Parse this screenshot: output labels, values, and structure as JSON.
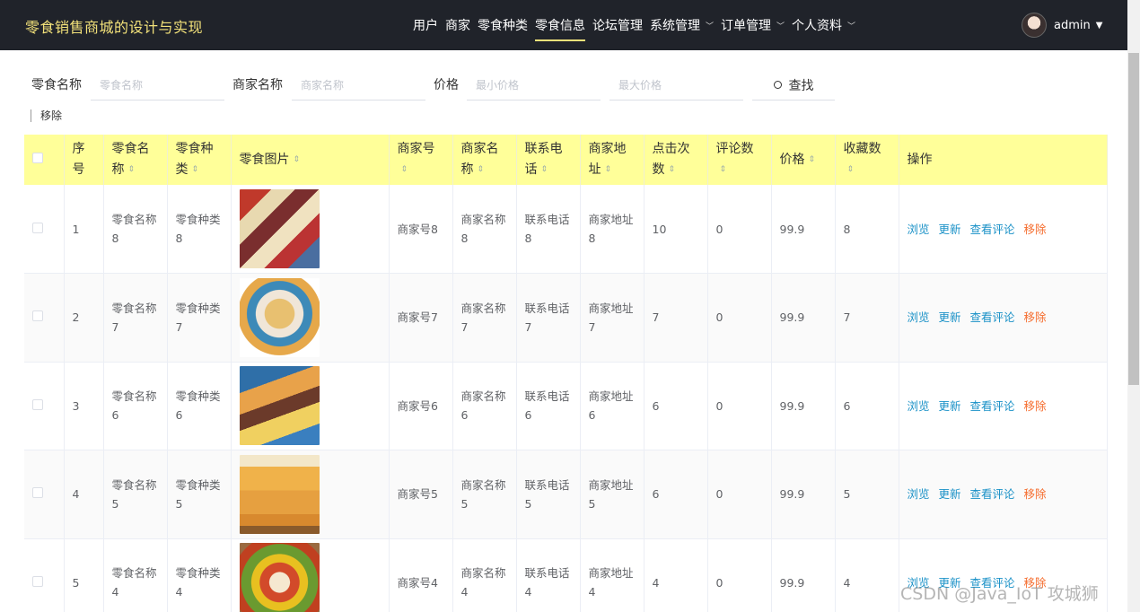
{
  "app": {
    "title": "零食销售商城的设计与实现"
  },
  "nav": {
    "items": [
      {
        "label": "用户",
        "dropdown": false,
        "active": false
      },
      {
        "label": "商家",
        "dropdown": false,
        "active": false
      },
      {
        "label": "零食种类",
        "dropdown": false,
        "active": false
      },
      {
        "label": "零食信息",
        "dropdown": false,
        "active": true
      },
      {
        "label": "论坛管理",
        "dropdown": false,
        "active": false
      },
      {
        "label": "系统管理",
        "dropdown": true,
        "active": false
      },
      {
        "label": "订单管理",
        "dropdown": true,
        "active": false
      },
      {
        "label": "个人资料",
        "dropdown": true,
        "active": false
      }
    ]
  },
  "user": {
    "name": "admin"
  },
  "search": {
    "snack_name_label": "零食名称",
    "snack_name_placeholder": "零食名称",
    "merchant_name_label": "商家名称",
    "merchant_name_placeholder": "商家名称",
    "price_label": "价格",
    "min_price_placeholder": "最小价格",
    "max_price_placeholder": "最大价格",
    "search_button": "查找"
  },
  "toolbar": {
    "remove_label": "移除"
  },
  "table": {
    "headers": {
      "index": "序号",
      "snack_name": "零食名称",
      "snack_type": "零食种类",
      "snack_image": "零食图片",
      "merchant_no": "商家号",
      "merchant_name": "商家名称",
      "phone": "联系电话",
      "address": "商家地址",
      "clicks": "点击次数",
      "comments": "评论数",
      "price": "价格",
      "favorites": "收藏数",
      "actions": "操作"
    },
    "actions": {
      "view": "浏览",
      "update": "更新",
      "comments": "查看评论",
      "remove": "移除"
    },
    "rows": [
      {
        "index": "1",
        "snack_name": "零食名称8",
        "snack_type": "零食种类8",
        "merchant_no": "商家号8",
        "merchant_name": "商家名称8",
        "phone": "联系电话8",
        "address": "商家地址8",
        "clicks": "10",
        "comments": "0",
        "price": "99.9",
        "favorites": "8"
      },
      {
        "index": "2",
        "snack_name": "零食名称7",
        "snack_type": "零食种类7",
        "merchant_no": "商家号7",
        "merchant_name": "商家名称7",
        "phone": "联系电话7",
        "address": "商家地址7",
        "clicks": "7",
        "comments": "0",
        "price": "99.9",
        "favorites": "7"
      },
      {
        "index": "3",
        "snack_name": "零食名称6",
        "snack_type": "零食种类6",
        "merchant_no": "商家号6",
        "merchant_name": "商家名称6",
        "phone": "联系电话6",
        "address": "商家地址6",
        "clicks": "6",
        "comments": "0",
        "price": "99.9",
        "favorites": "6"
      },
      {
        "index": "4",
        "snack_name": "零食名称5",
        "snack_type": "零食种类5",
        "merchant_no": "商家号5",
        "merchant_name": "商家名称5",
        "phone": "联系电话5",
        "address": "商家地址5",
        "clicks": "6",
        "comments": "0",
        "price": "99.9",
        "favorites": "5"
      },
      {
        "index": "5",
        "snack_name": "零食名称4",
        "snack_type": "零食种类4",
        "merchant_no": "商家号4",
        "merchant_name": "商家名称4",
        "phone": "联系电话4",
        "address": "商家地址4",
        "clicks": "4",
        "comments": "0",
        "price": "99.9",
        "favorites": "4"
      }
    ]
  },
  "watermark": "CSDN @Java_IoT 攻城狮",
  "colors": {
    "header_bg": "#20232a",
    "accent": "#f3e27a",
    "table_head_bg": "#ffff99",
    "link": "#1a91c7",
    "danger": "#f56c2d"
  }
}
